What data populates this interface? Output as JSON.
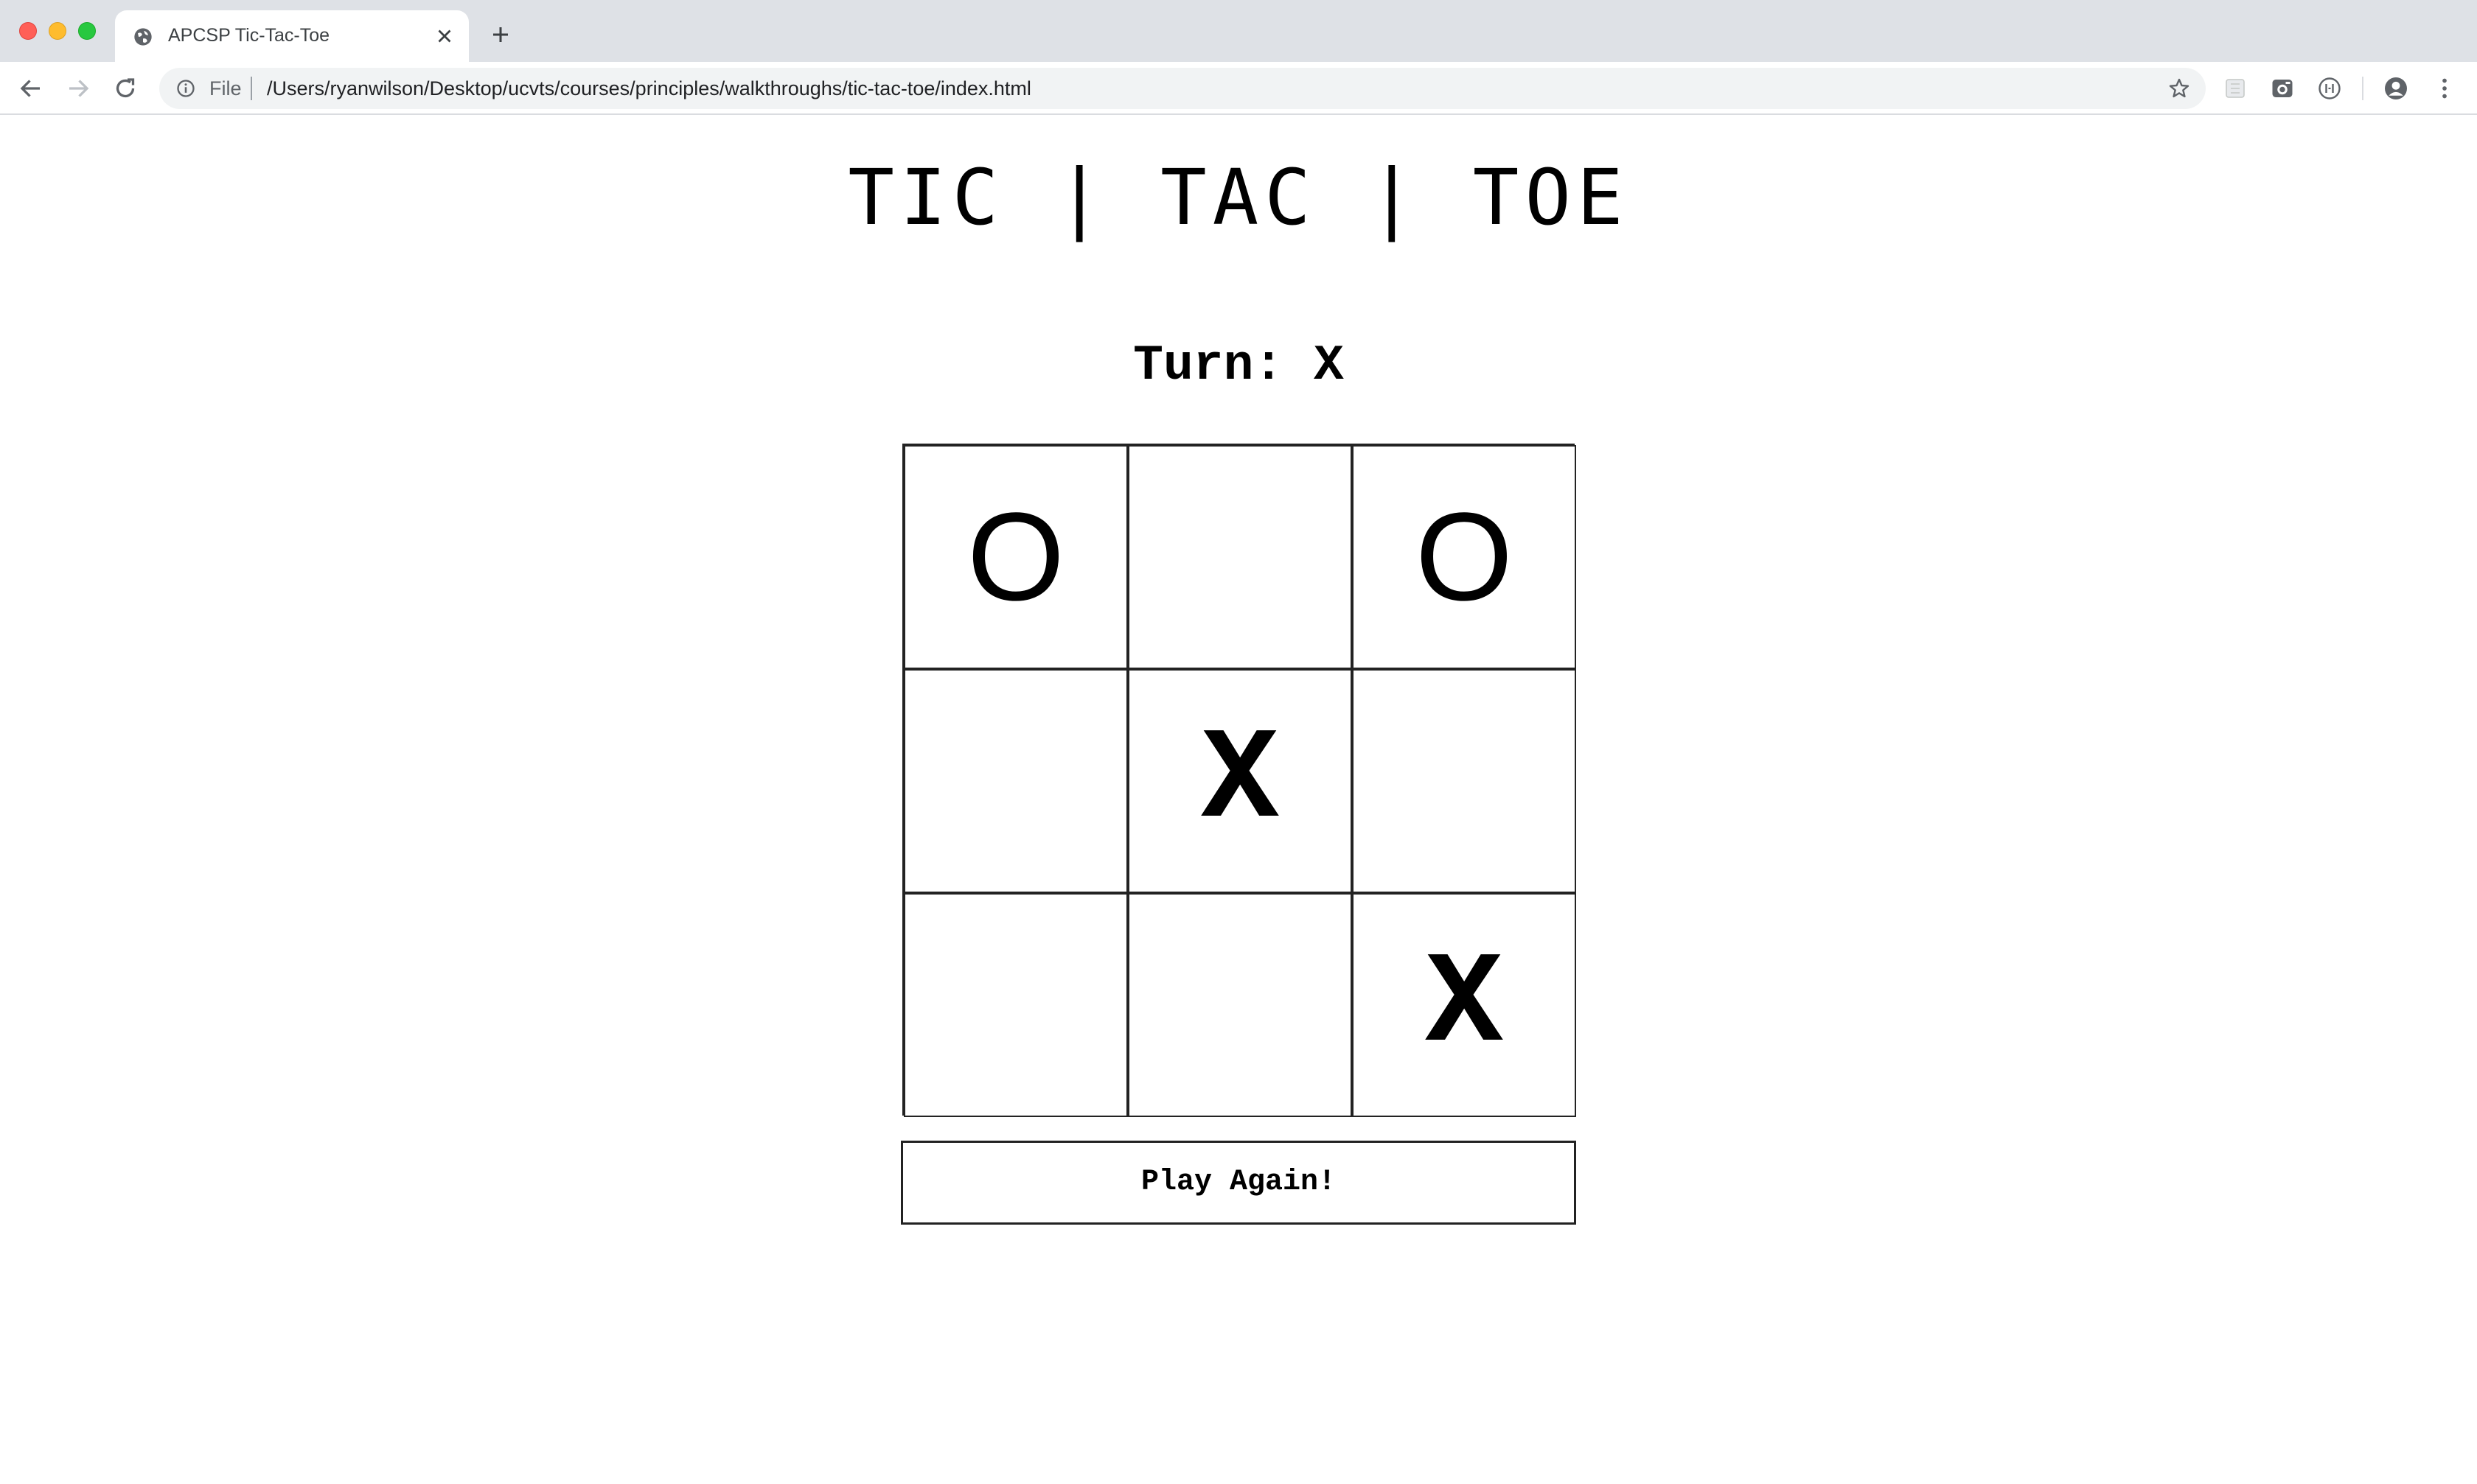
{
  "browser": {
    "tab_title": "APCSP Tic-Tac-Toe",
    "new_tab_icon": "plus-icon",
    "file_label": "File",
    "url": "/Users/ryanwilson/Desktop/ucvts/courses/principles/walkthroughs/tic-tac-toe/index.html"
  },
  "page": {
    "title": "TIC | TAC | TOE",
    "turn_label": "Turn: ",
    "turn_value": "X",
    "board": [
      [
        "O",
        "",
        "O"
      ],
      [
        "",
        "X",
        ""
      ],
      [
        "",
        "",
        "X"
      ]
    ],
    "play_again_label": "Play Again!"
  }
}
